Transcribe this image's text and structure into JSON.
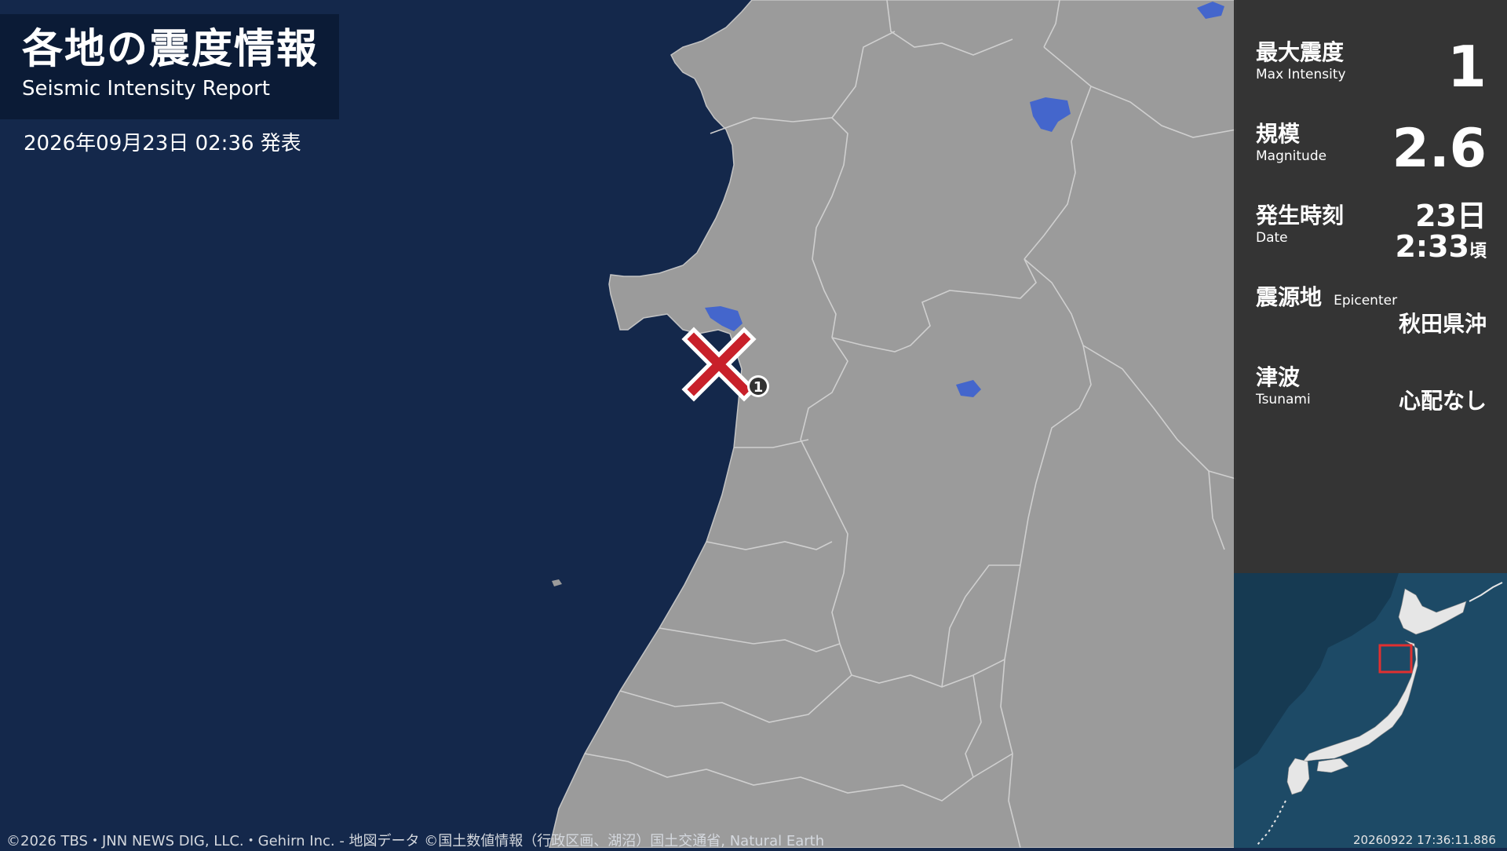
{
  "header": {
    "title": "各地の震度情報",
    "subtitle": "Seismic Intensity Report",
    "issued": "2026年09月23日 02:36 発表"
  },
  "info": {
    "max_intensity": {
      "label_ja": "最大震度",
      "label_en": "Max Intensity",
      "value": "1"
    },
    "magnitude": {
      "label_ja": "規模",
      "label_en": "Magnitude",
      "value": "2.6"
    },
    "date": {
      "label_ja": "発生時刻",
      "label_en": "Date",
      "day": "23日",
      "time": "2:33",
      "approx": "頃"
    },
    "epicenter": {
      "label_ja": "震源地",
      "label_en": "Epicenter",
      "value": "秋田県沖"
    },
    "tsunami": {
      "label_ja": "津波",
      "label_en": "Tsunami",
      "value": "心配なし"
    }
  },
  "map": {
    "observation_marker": "1",
    "colors": {
      "sea": "#14284b",
      "land": "#9b9b9b",
      "lake": "#4466cc",
      "epicenter": "#c8202a",
      "inset_sea": "#1d4a66",
      "inset_frame": "#e03030"
    }
  },
  "footer": {
    "credit": "©2026 TBS・JNN NEWS DIG, LLC.・Gehirn Inc. - 地図データ ©国土数値情報（行政区画、湖沼）国土交通省, Natural Earth",
    "timestamp": "20260922 17:36:11.886"
  }
}
